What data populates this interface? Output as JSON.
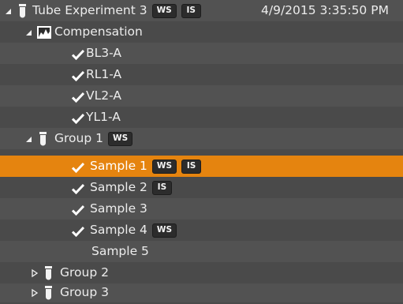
{
  "tree": {
    "root": {
      "label": "Tube Experiment 3",
      "badges": [
        "WS",
        "IS"
      ],
      "timestamp": "4/9/2015 3:35:50 PM"
    },
    "compensation": {
      "label": "Compensation",
      "items": [
        "BL3-A",
        "RL1-A",
        "VL2-A",
        "YL1-A"
      ]
    },
    "group1": {
      "label": "Group 1",
      "badges": [
        "WS"
      ],
      "samples": [
        {
          "label": "Sample 1",
          "checked": true,
          "selected": true,
          "badges": [
            "WS",
            "IS"
          ]
        },
        {
          "label": "Sample 2",
          "checked": true,
          "selected": false,
          "badges": [
            "IS"
          ]
        },
        {
          "label": "Sample 3",
          "checked": true,
          "selected": false,
          "badges": []
        },
        {
          "label": "Sample 4",
          "checked": true,
          "selected": false,
          "badges": [
            "WS"
          ]
        },
        {
          "label": "Sample 5",
          "checked": false,
          "selected": false,
          "badges": []
        }
      ]
    },
    "group2": {
      "label": "Group 2"
    },
    "group3": {
      "label": "Group 3"
    }
  },
  "colors": {
    "background": "#4a4a4a",
    "alternate_row": "#525252",
    "selected_row": "#e5840f",
    "badge_background": "#2c2c2c",
    "text": "#ececec"
  },
  "icons": {
    "expanded": "triangle-down-right-icon",
    "collapsed": "triangle-right-icon",
    "tube": "test-tube-icon",
    "compensation": "compensation-chart-icon",
    "check": "checkmark-icon"
  }
}
